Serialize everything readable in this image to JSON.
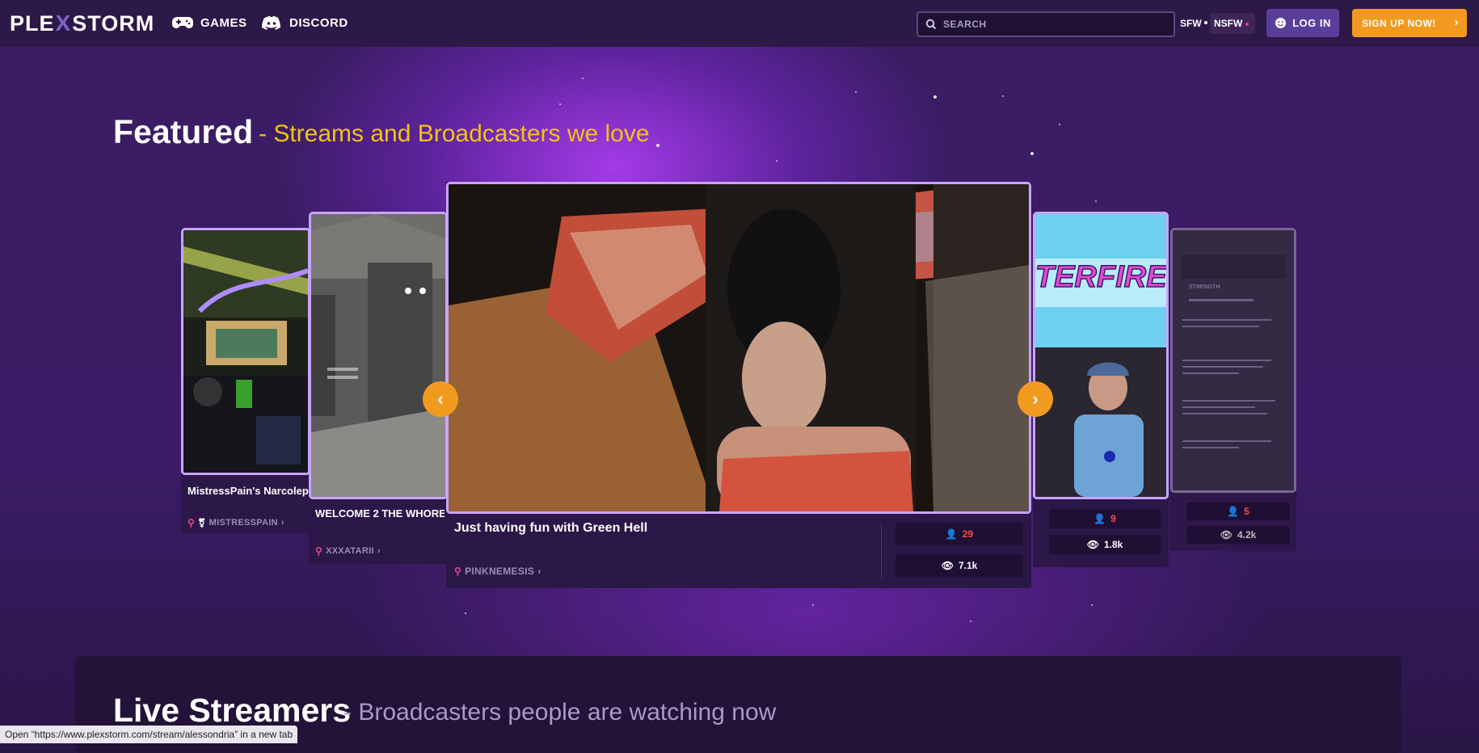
{
  "header": {
    "logo_left": "PLE",
    "logo_mid": "X",
    "logo_right": "STORM",
    "nav": [
      {
        "label": "GAMES",
        "icon": "gamepad-icon"
      },
      {
        "label": "DISCORD",
        "icon": "discord-icon"
      }
    ],
    "search_placeholder": "SEARCH",
    "sfw_label": "SFW",
    "nsfw_label": "NSFW",
    "login_label": "LOG IN",
    "signup_label": "SIGN UP NOW!"
  },
  "featured": {
    "title": "Featured",
    "subtitle": "- Streams and Broadcasters we love",
    "cards": [
      {
        "title": "MistressPain's Narcolepsy",
        "user": "MISTRESSPAIN"
      },
      {
        "title": "WELCOME 2 THE WHORE",
        "user": "XXXATARII"
      },
      {
        "title": "Just having fun with Green Hell",
        "user": "PINKNEMESIS",
        "followers": "29",
        "views": "7.1k"
      },
      {
        "title": "",
        "user": "",
        "followers": "9",
        "views": "1.8k",
        "thumb_text": "TERFIRE"
      },
      {
        "title": "",
        "user": "",
        "followers": "5",
        "views": "4.2k",
        "thumb_text": "STRENGTH"
      }
    ]
  },
  "live": {
    "title": "Live Streamers",
    "subtitle": "- Broadcasters people are watching now"
  },
  "status_bar": "Open “https://www.plexstorm.com/stream/alessondria” in a new tab",
  "colors": {
    "accent_orange": "#f29a1f",
    "accent_yellow": "#f4c21a",
    "card_border": "#c8a4ff",
    "pin_pink": "#e8488e"
  }
}
